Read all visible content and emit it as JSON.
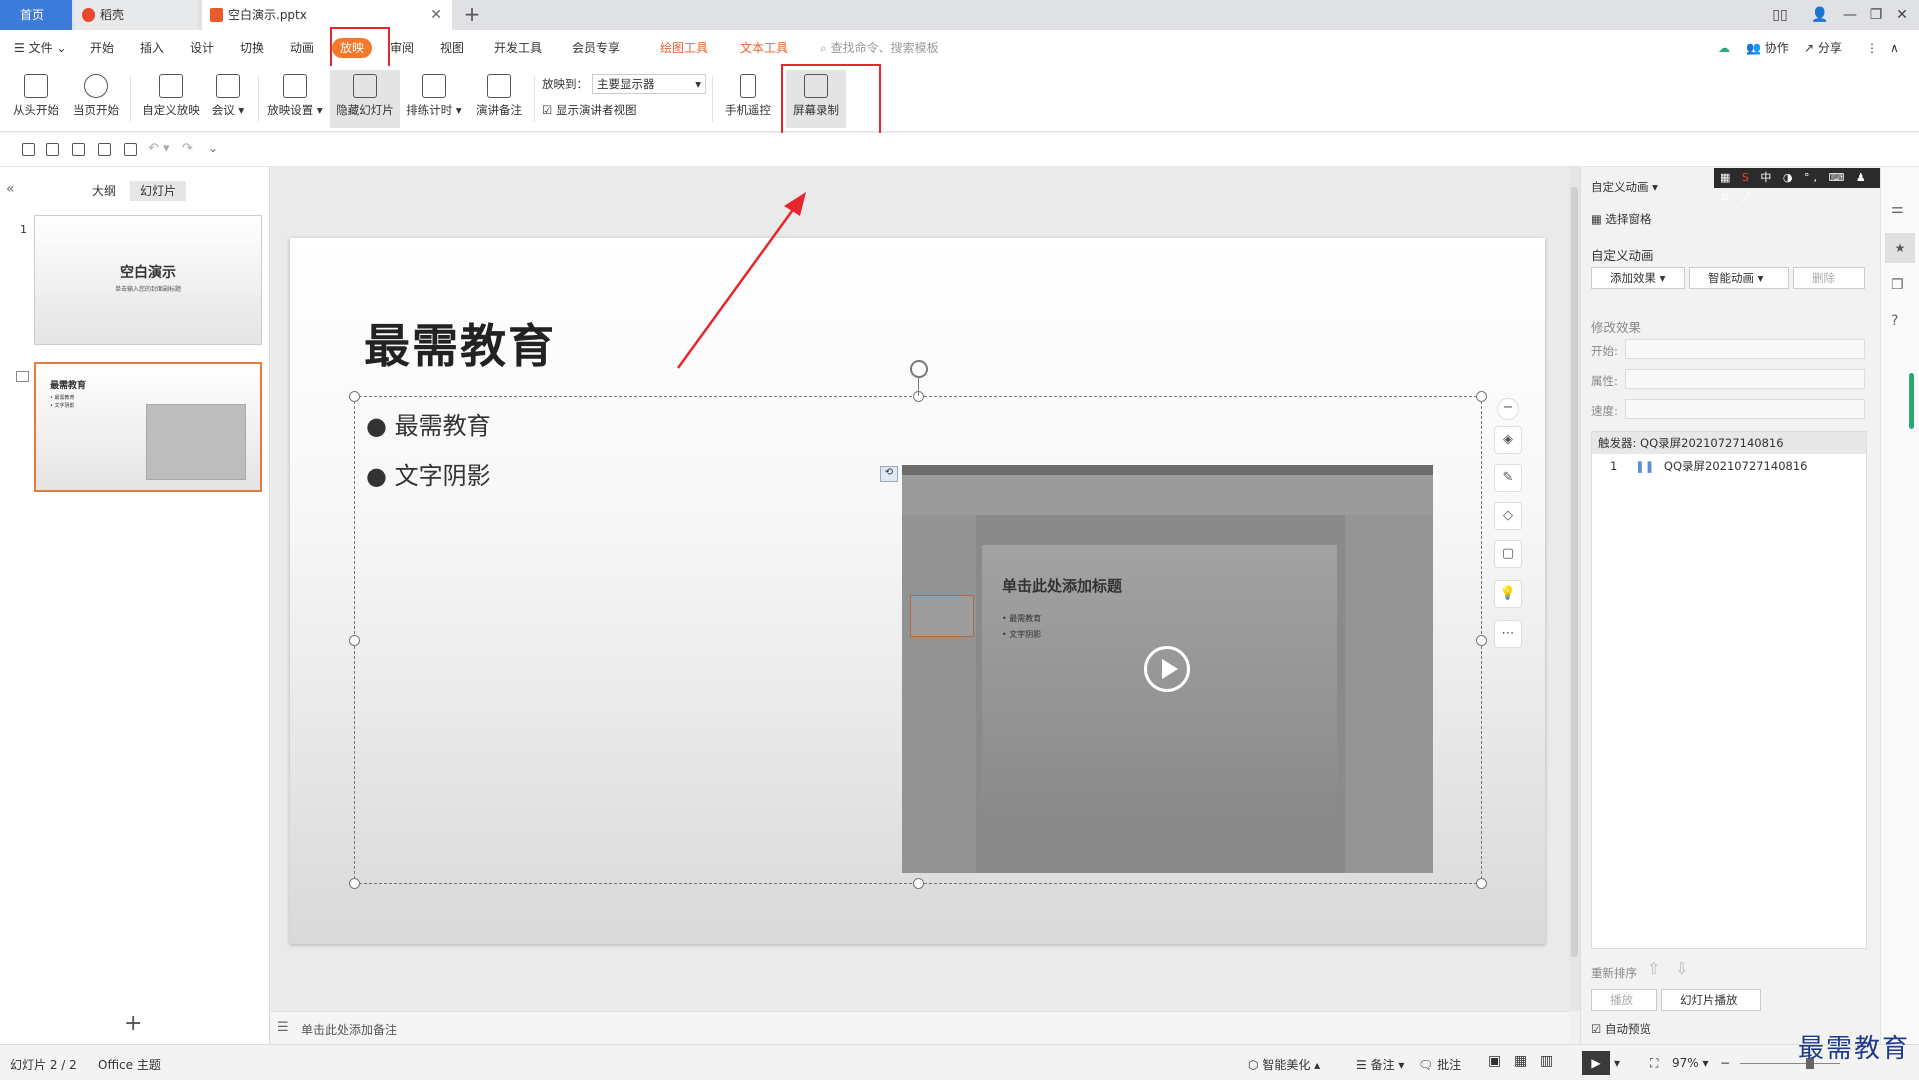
{
  "tabs": {
    "home": "首页",
    "daoke": "稻壳",
    "file": "空白演示.pptx",
    "add": "+"
  },
  "menu": {
    "file": "文件",
    "items": [
      "开始",
      "插入",
      "设计",
      "切换",
      "动画",
      "放映",
      "审阅",
      "视图",
      "开发工具",
      "会员专享"
    ],
    "drawing_tools": "绘图工具",
    "text_tools": "文本工具",
    "search_placeholder": "查找命令、搜索模板",
    "collab": "协作",
    "share": "分享"
  },
  "ribbon": {
    "from_start": "从头开始",
    "from_current": "当页开始",
    "custom_show": "自定义放映",
    "meeting": "会议",
    "show_settings": "放映设置",
    "hide_slide": "隐藏幻灯片",
    "rehearse": "排练计时",
    "speaker_notes": "演讲备注",
    "play_to_label": "放映到：",
    "play_to_value": "主要显示器",
    "presenter_view": "显示演讲者视图",
    "phone_remote": "手机遥控",
    "screen_record": "屏幕录制"
  },
  "left_panel": {
    "outline_tab": "大纲",
    "slides_tab": "幻灯片",
    "slide1_num": "1",
    "slide1_title": "空白演示",
    "slide1_sub": "单击输入您的封面副标题",
    "slide2_num": "2",
    "slide2_title": "最需教育",
    "slide2_bullet1": "• 最需教育",
    "slide2_bullet2": "• 文字阴影",
    "add": "+"
  },
  "slide": {
    "title": "最需教育",
    "bullet1": "最需教育",
    "bullet2": "文字阴影"
  },
  "video": {
    "title_placeholder": "单击此处添加标题",
    "bullet1": "• 最需教育",
    "bullet2": "• 文字阴影"
  },
  "notes": {
    "placeholder": "单击此处添加备注"
  },
  "right_pane": {
    "header": "自定义动画",
    "select_pane": "选择窗格",
    "custom_anim": "自定义动画",
    "add_effect": "添加效果",
    "smart_anim": "智能动画",
    "delete": "删除",
    "modify": "修改效果",
    "start": "开始:",
    "property": "属性:",
    "speed": "速度:",
    "trigger": "触发器: QQ录屏20210727140816",
    "item_num": "1",
    "item_name": "QQ录屏20210727140816",
    "reorder": "重新排序",
    "play": "播放",
    "slideshow": "幻灯片播放",
    "autopreview": "自动预览"
  },
  "statusbar": {
    "slide_info": "幻灯片 2 / 2",
    "theme": "Office 主题",
    "beautify": "智能美化",
    "notes": "备注",
    "comments": "批注",
    "zoom": "97%"
  },
  "watermark": "最需教育",
  "colors": {
    "accent_orange": "#f4772a",
    "highlight_red": "#e5262e",
    "home_blue": "#3d7bd8"
  }
}
